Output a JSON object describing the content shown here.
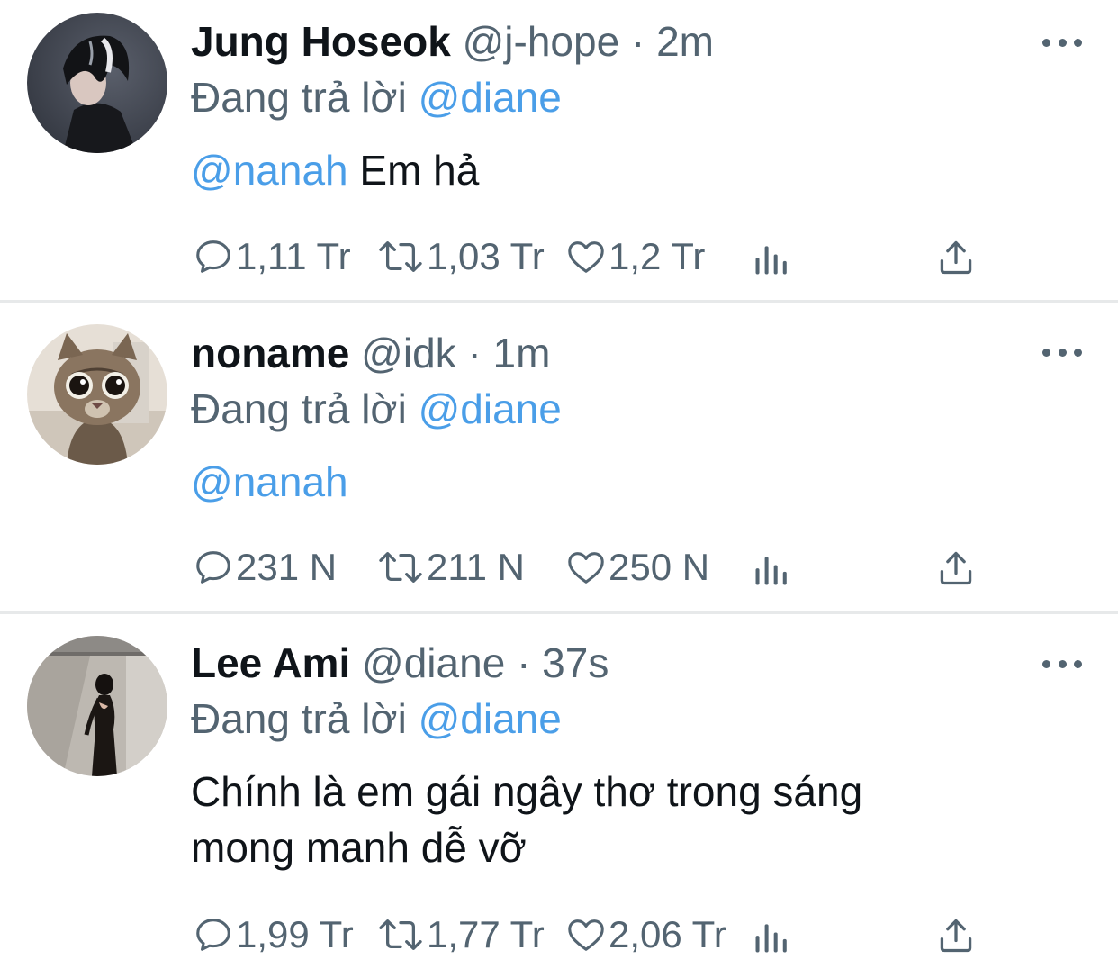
{
  "replying_label": "Đang trả lời",
  "tweets": [
    {
      "name": "Jung Hoseok",
      "handle": "@j-hope",
      "separator": "·",
      "time": "2m",
      "replying_to": "@diane",
      "mention": "@nanah",
      "text": "Em hả",
      "replies": "1,11 Tr",
      "retweets": "1,03 Tr",
      "likes": "1,2 Tr"
    },
    {
      "name": "noname",
      "handle": "@idk",
      "separator": "·",
      "time": "1m",
      "replying_to": "@diane",
      "mention": "@nanah",
      "text": "",
      "replies": "231 N",
      "retweets": "211 N",
      "likes": "250 N"
    },
    {
      "name": "Lee Ami",
      "handle": "@diane",
      "separator": "·",
      "time": "37s",
      "replying_to": "@diane",
      "mention": "",
      "text_line1": "Chính là em gái ngây thơ trong sáng",
      "text_line2": "mong manh dễ vỡ",
      "replies": "1,99 Tr",
      "retweets": "1,77 Tr",
      "likes": "2,06 Tr"
    }
  ],
  "colors": {
    "text": "#0f1419",
    "secondary": "#536471",
    "link": "#4a9ee8",
    "divider": "#e7e9ea"
  },
  "icons": [
    "reply-icon",
    "retweet-icon",
    "like-icon",
    "views-icon",
    "share-icon",
    "more-icon"
  ]
}
